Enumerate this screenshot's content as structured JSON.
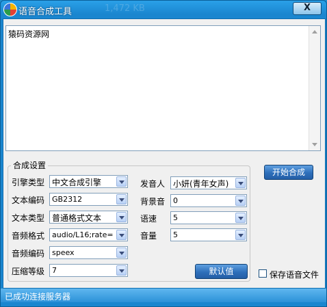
{
  "window": {
    "title": "语音合成工具",
    "behind_text": "1,472 KB",
    "close_glyph": "X"
  },
  "editor": {
    "text": "猿码资源网"
  },
  "settings": {
    "group_label": "合成设置",
    "engine_type": {
      "label": "引擎类型",
      "value": "中文合成引擎"
    },
    "text_encoding": {
      "label": "文本编码",
      "value": "GB2312"
    },
    "text_type": {
      "label": "文本类型",
      "value": "普通格式文本"
    },
    "audio_format": {
      "label": "音频格式",
      "value": "audio/L16;rate="
    },
    "audio_encoding": {
      "label": "音频编码",
      "value": "speex"
    },
    "compression_level": {
      "label": "压缩等级",
      "value": "7"
    },
    "speaker": {
      "label": "发音人",
      "value": "小妍(青年女声)"
    },
    "background_sound": {
      "label": "背景音",
      "value": "0"
    },
    "speed": {
      "label": "语速",
      "value": "5"
    },
    "volume": {
      "label": "音量",
      "value": "5"
    },
    "default_button": "默认值"
  },
  "actions": {
    "start_button": "开始合成",
    "save_checkbox_label": "保存语音文件"
  },
  "status": {
    "text": "已成功连接服务器"
  },
  "colors": {
    "title_blue": "#1a86cf",
    "button_blue": "#2e6fba"
  }
}
